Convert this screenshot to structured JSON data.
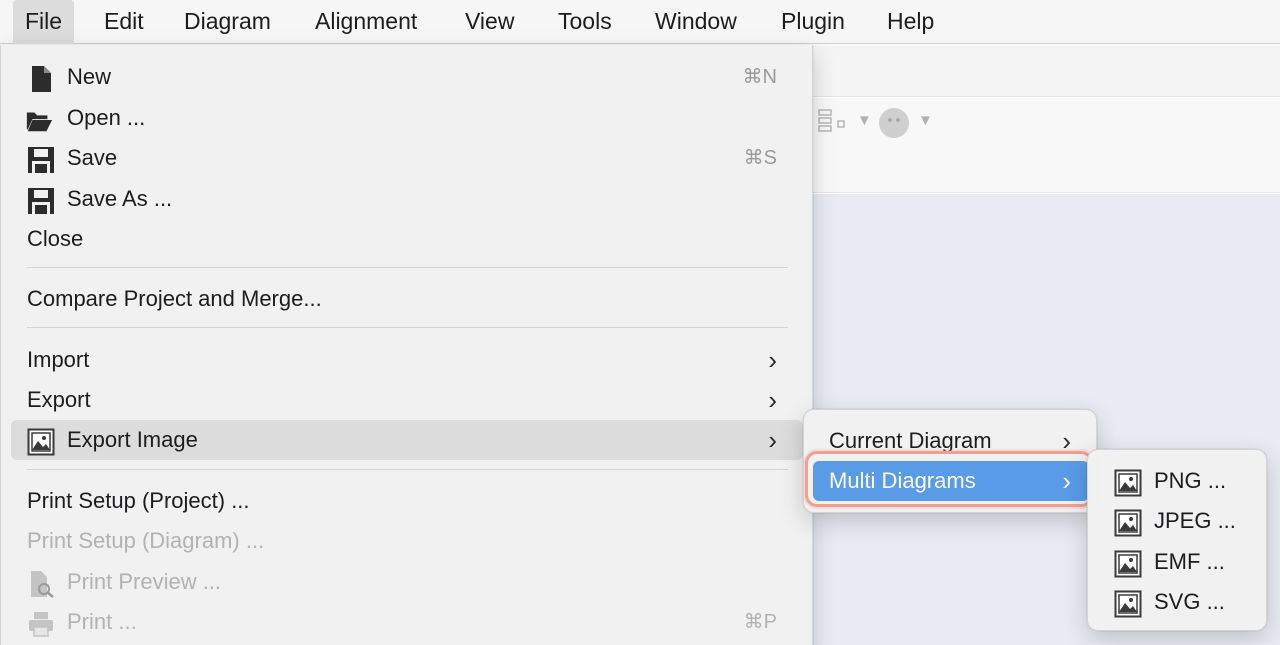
{
  "menubar": {
    "items": [
      "File",
      "Edit",
      "Diagram",
      "Alignment",
      "View",
      "Tools",
      "Window",
      "Plugin",
      "Help"
    ]
  },
  "file_menu": {
    "new": {
      "label": "New",
      "shortcut": "⌘N"
    },
    "open": {
      "label": "Open ..."
    },
    "save": {
      "label": "Save",
      "shortcut": "⌘S"
    },
    "save_as": {
      "label": "Save As ..."
    },
    "close": {
      "label": "Close"
    },
    "compare": {
      "label": "Compare Project and Merge..."
    },
    "import": {
      "label": "Import"
    },
    "export": {
      "label": "Export"
    },
    "export_image": {
      "label": "Export Image"
    },
    "print_setup_project": {
      "label": "Print Setup (Project) ..."
    },
    "print_setup_diagram": {
      "label": "Print Setup (Diagram) ..."
    },
    "print_preview": {
      "label": "Print Preview ..."
    },
    "print": {
      "label": "Print ...",
      "shortcut": "⌘P"
    }
  },
  "export_image_menu": {
    "current_diagram": {
      "label": "Current Diagram"
    },
    "multi_diagrams": {
      "label": "Multi Diagrams"
    }
  },
  "format_menu": {
    "png": {
      "label": "PNG ..."
    },
    "jpeg": {
      "label": "JPEG ..."
    },
    "emf": {
      "label": "EMF ..."
    },
    "svg": {
      "label": "SVG ..."
    }
  },
  "colors": {
    "selected": "#5a9be8",
    "highlight_ring": "#f0a08f",
    "disabled_text": "#b2b2b2"
  }
}
